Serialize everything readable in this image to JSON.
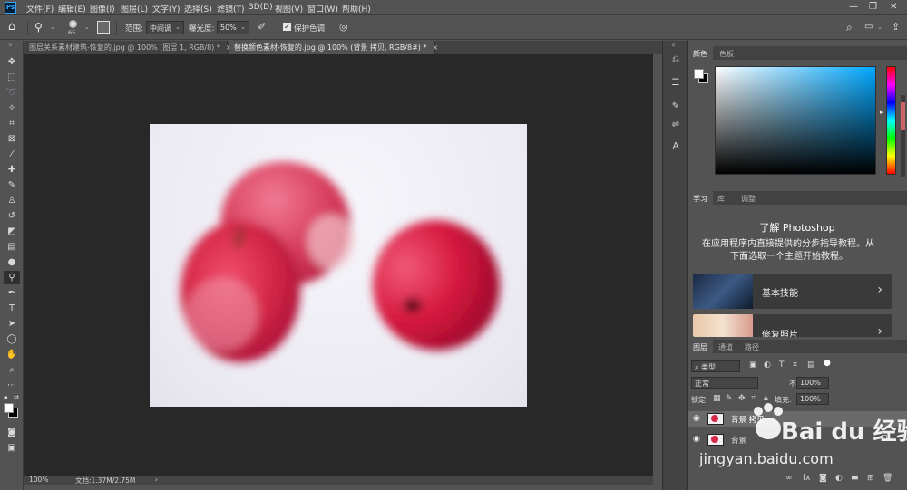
{
  "app": {
    "logo": "Ps"
  },
  "menu": [
    "文件(F)",
    "编辑(E)",
    "图像(I)",
    "图层(L)",
    "文字(Y)",
    "选择(S)",
    "滤镜(T)",
    "3D(D)",
    "视图(V)",
    "窗口(W)",
    "帮助(H)"
  ],
  "window_controls": {
    "minimize": "—",
    "restore": "❐",
    "close": "✕"
  },
  "options": {
    "brush_size": "65",
    "range_label": "范围:",
    "range_value": "中间调",
    "exposure_label": "曝光度:",
    "exposure_value": "50%",
    "protect_label": "保护色调",
    "protect_checked": true
  },
  "tabs": [
    {
      "label": "图层关系素材建筑-恢复的.jpg @ 100% (图层 1, RGB/8) *",
      "active": false
    },
    {
      "label": "替换颜色素材-恢复的.jpg @ 100% (背景 拷贝, RGB/8#) *",
      "active": true
    }
  ],
  "tab_close_glyph": "×",
  "status": {
    "zoom": "100%",
    "doc_info": "文档:1.37M/2.75M",
    "arrow": "›"
  },
  "color_panel": {
    "tabs": [
      "颜色",
      "色板"
    ],
    "accent": "#00a7ff"
  },
  "learn_panel": {
    "tabs": [
      "学习",
      "库",
      "调整"
    ],
    "title": "了解 Photoshop",
    "desc_line1": "在应用程序内直接提供的分步指导教程。从",
    "desc_line2": "下面选取一个主题开始教程。",
    "cards": [
      {
        "label": "基本技能"
      },
      {
        "label": "修复照片"
      }
    ],
    "chevron": "›"
  },
  "layers_panel": {
    "tabs": [
      "图层",
      "通道",
      "路径"
    ],
    "filter_label": "类型",
    "blend_mode": "正常",
    "opacity_label": "不透明度:",
    "opacity_value": "100%",
    "lock_label": "锁定:",
    "fill_label": "填充:",
    "fill_value": "100%",
    "layers": [
      {
        "name": "背景 拷贝",
        "selected": true
      },
      {
        "name": "背景",
        "selected": false
      }
    ]
  },
  "watermark": {
    "brand": "Bai du 经验",
    "url": "jingyan.baidu.com"
  }
}
